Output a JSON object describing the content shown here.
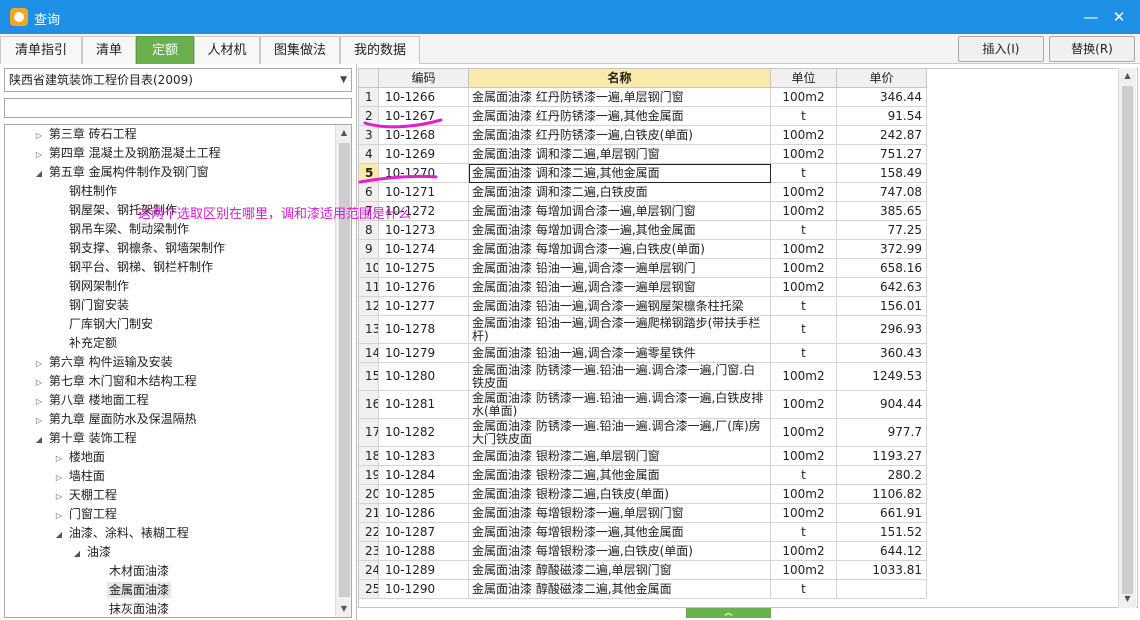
{
  "window": {
    "title": "查询",
    "minimize_icon": "minimize-icon",
    "close_icon": "close-icon"
  },
  "tabs": [
    {
      "label": "清单指引",
      "active": false
    },
    {
      "label": "清单",
      "active": false
    },
    {
      "label": "定额",
      "active": true
    },
    {
      "label": "人材机",
      "active": false
    },
    {
      "label": "图集做法",
      "active": false
    },
    {
      "label": "我的数据",
      "active": false
    }
  ],
  "toolbar": {
    "insert_label": "插入(I)",
    "replace_label": "替换(R)"
  },
  "library": {
    "selected": "陕西省建筑装饰工程价目表(2009)"
  },
  "search": {
    "value": ""
  },
  "tree": [
    {
      "label": "第三章 砖石工程",
      "toggle": "▷"
    },
    {
      "label": "第四章 混凝土及钢筋混凝土工程",
      "toggle": "▷"
    },
    {
      "label": "第五章 金属构件制作及钢门窗",
      "toggle": "◢"
    },
    {
      "label": "钢柱制作",
      "toggle": ""
    },
    {
      "label": "钢屋架、钢托架制作",
      "toggle": ""
    },
    {
      "label": "钢吊车梁、制动梁制作",
      "toggle": ""
    },
    {
      "label": "钢支撑、钢檩条、钢墙架制作",
      "toggle": ""
    },
    {
      "label": "钢平台、钢梯、钢栏杆制作",
      "toggle": ""
    },
    {
      "label": "钢网架制作",
      "toggle": ""
    },
    {
      "label": "钢门窗安装",
      "toggle": ""
    },
    {
      "label": "厂库钢大门制安",
      "toggle": ""
    },
    {
      "label": "补充定额",
      "toggle": ""
    },
    {
      "label": "第六章 构件运输及安装",
      "toggle": "▷"
    },
    {
      "label": "第七章 木门窗和木结构工程",
      "toggle": "▷"
    },
    {
      "label": "第八章 楼地面工程",
      "toggle": "▷"
    },
    {
      "label": "第九章 屋面防水及保温隔热",
      "toggle": "▷"
    },
    {
      "label": "第十章 装饰工程",
      "toggle": "◢"
    },
    {
      "label": "楼地面",
      "toggle": "▷"
    },
    {
      "label": "墙柱面",
      "toggle": "▷"
    },
    {
      "label": "天棚工程",
      "toggle": "▷"
    },
    {
      "label": "门窗工程",
      "toggle": "▷"
    },
    {
      "label": "油漆、涂料、裱糊工程",
      "toggle": "◢"
    },
    {
      "label": "油漆",
      "toggle": "◢"
    },
    {
      "label": "木材面油漆",
      "toggle": ""
    },
    {
      "label": "金属面油漆",
      "toggle": ""
    },
    {
      "label": "抹灰面油漆",
      "toggle": ""
    }
  ],
  "grid": {
    "headers": {
      "code": "编码",
      "name": "名称",
      "unit": "单位",
      "price": "单价"
    },
    "rows": [
      {
        "no": "1",
        "code": "10-1266",
        "name": "金属面油漆 红丹防锈漆一遍,单层钢门窗",
        "unit": "100m2",
        "price": "346.44"
      },
      {
        "no": "2",
        "code": "10-1267",
        "name": "金属面油漆 红丹防锈漆一遍,其他金属面",
        "unit": "t",
        "price": "91.54"
      },
      {
        "no": "3",
        "code": "10-1268",
        "name": "金属面油漆 红丹防锈漆一遍,白铁皮(单面)",
        "unit": "100m2",
        "price": "242.87"
      },
      {
        "no": "4",
        "code": "10-1269",
        "name": "金属面油漆 调和漆二遍,单层钢门窗",
        "unit": "100m2",
        "price": "751.27"
      },
      {
        "no": "5",
        "code": "10-1270",
        "name": "金属面油漆 调和漆二遍,其他金属面",
        "unit": "t",
        "price": "158.49"
      },
      {
        "no": "6",
        "code": "10-1271",
        "name": "金属面油漆 调和漆二遍,白铁皮面",
        "unit": "100m2",
        "price": "747.08"
      },
      {
        "no": "7",
        "code": "10-1272",
        "name": "金属面油漆 每增加调合漆一遍,单层钢门窗",
        "unit": "100m2",
        "price": "385.65"
      },
      {
        "no": "8",
        "code": "10-1273",
        "name": "金属面油漆 每增加调合漆一遍,其他金属面",
        "unit": "t",
        "price": "77.25"
      },
      {
        "no": "9",
        "code": "10-1274",
        "name": "金属面油漆 每增加调合漆一遍,白铁皮(单面)",
        "unit": "100m2",
        "price": "372.99"
      },
      {
        "no": "10",
        "code": "10-1275",
        "name": "金属面油漆 铅油一遍,调合漆一遍单层钢门",
        "unit": "100m2",
        "price": "658.16"
      },
      {
        "no": "11",
        "code": "10-1276",
        "name": "金属面油漆 铅油一遍,调合漆一遍单层钢窗",
        "unit": "100m2",
        "price": "642.63"
      },
      {
        "no": "12",
        "code": "10-1277",
        "name": "金属面油漆 铅油一遍,调合漆一遍钢屋架檩条柱托梁",
        "unit": "t",
        "price": "156.01"
      },
      {
        "no": "13",
        "code": "10-1278",
        "name": "金属面油漆 铅油一遍,调合漆一遍爬梯钢踏步(带扶手栏杆)",
        "unit": "t",
        "price": "296.93"
      },
      {
        "no": "14",
        "code": "10-1279",
        "name": "金属面油漆 铅油一遍,调合漆一遍零星铁件",
        "unit": "t",
        "price": "360.43"
      },
      {
        "no": "15",
        "code": "10-1280",
        "name": "金属面油漆 防锈漆一遍.铅油一遍.调合漆一遍,门窗.白铁皮面",
        "unit": "100m2",
        "price": "1249.53"
      },
      {
        "no": "16",
        "code": "10-1281",
        "name": "金属面油漆 防锈漆一遍.铅油一遍.调合漆一遍,白铁皮排水(单面)",
        "unit": "100m2",
        "price": "904.44"
      },
      {
        "no": "17",
        "code": "10-1282",
        "name": "金属面油漆 防锈漆一遍.铅油一遍.调合漆一遍,厂(库)房大门铁皮面",
        "unit": "100m2",
        "price": "977.7"
      },
      {
        "no": "18",
        "code": "10-1283",
        "name": "金属面油漆 银粉漆二遍,单层钢门窗",
        "unit": "100m2",
        "price": "1193.27"
      },
      {
        "no": "19",
        "code": "10-1284",
        "name": "金属面油漆 银粉漆二遍,其他金属面",
        "unit": "t",
        "price": "280.2"
      },
      {
        "no": "20",
        "code": "10-1285",
        "name": "金属面油漆 银粉漆二遍,白铁皮(单面)",
        "unit": "100m2",
        "price": "1106.82"
      },
      {
        "no": "21",
        "code": "10-1286",
        "name": "金属面油漆 每增银粉漆一遍,单层钢门窗",
        "unit": "100m2",
        "price": "661.91"
      },
      {
        "no": "22",
        "code": "10-1287",
        "name": "金属面油漆 每增银粉漆一遍,其他金属面",
        "unit": "t",
        "price": "151.52"
      },
      {
        "no": "23",
        "code": "10-1288",
        "name": "金属面油漆 每增银粉漆一遍,白铁皮(单面)",
        "unit": "100m2",
        "price": "644.12"
      },
      {
        "no": "24",
        "code": "10-1289",
        "name": "金属面油漆 醇酸磁漆二遍,单层钢门窗",
        "unit": "100m2",
        "price": "1033.81"
      },
      {
        "no": "25",
        "code": "10-1290",
        "name": "金属面油漆 醇酸磁漆二遍,其他金属面",
        "unit": "t",
        "price": ""
      }
    ]
  },
  "annotation": {
    "text": "这两个选取区别在哪里，调和漆适用范围是什么"
  },
  "colors": {
    "titlebar": "#1e90e6",
    "active_tab": "#6ab04c",
    "header_name": "#fae9a8",
    "annotation": "#d61dd6"
  }
}
